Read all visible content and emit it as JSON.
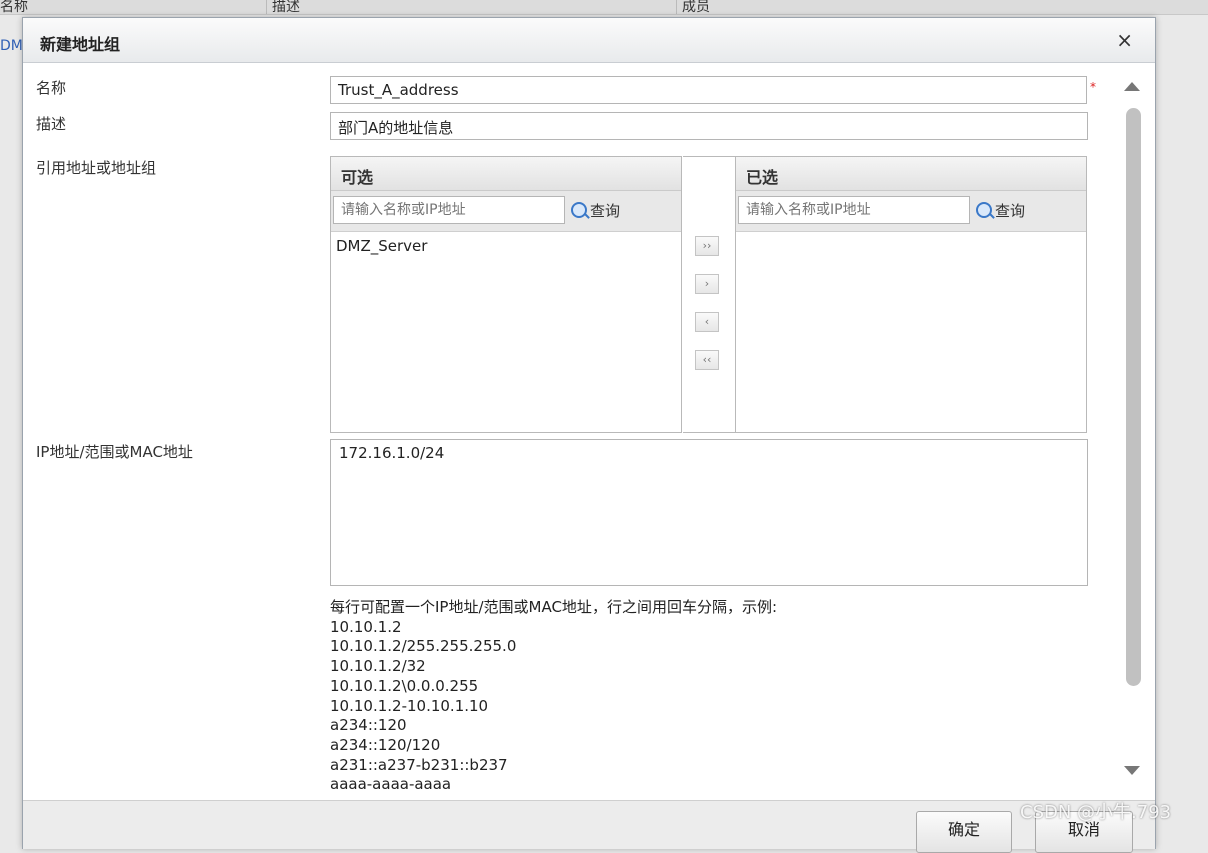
{
  "background": {
    "columns": [
      "名称",
      "描述",
      "成员"
    ],
    "row_link": "DM"
  },
  "dialog": {
    "title": "新建地址组",
    "close_glyph": "×",
    "fields": {
      "name_label": "名称",
      "name_value": "Trust_A_address",
      "required_mark": "*",
      "desc_label": "描述",
      "desc_value": "部门A的地址信息",
      "ref_label": "引用地址或地址组",
      "ip_label": "IP地址/范围或MAC地址",
      "ip_value": "172.16.1.0/24"
    },
    "available": {
      "header": "可选",
      "search_placeholder": "请输入名称或IP地址",
      "search_button": "查询",
      "items": [
        "DMZ_Server"
      ]
    },
    "selected": {
      "header": "已选",
      "search_placeholder": "请输入名称或IP地址",
      "search_button": "查询",
      "items": []
    },
    "transfer_buttons": {
      "add_all": "››",
      "add": "›",
      "remove": "‹",
      "remove_all": "‹‹"
    },
    "help": {
      "intro": "每行可配置一个IP地址/范围或MAC地址，行之间用回车分隔，示例:",
      "examples": [
        "10.10.1.2",
        "10.10.1.2/255.255.255.0",
        "10.10.1.2/32",
        "10.10.1.2\\0.0.0.255",
        "10.10.1.2-10.10.1.10",
        "a234::120",
        "a234::120/120",
        "a231::a237-b231::b237",
        "aaaa-aaaa-aaaa"
      ]
    },
    "footer": {
      "ok": "确定",
      "cancel": "取消"
    }
  },
  "watermark": "CSDN @小牛.793",
  "colors": {
    "link": "#2f5fb5",
    "required": "#d22222",
    "search_icon": "#3a78c8"
  }
}
